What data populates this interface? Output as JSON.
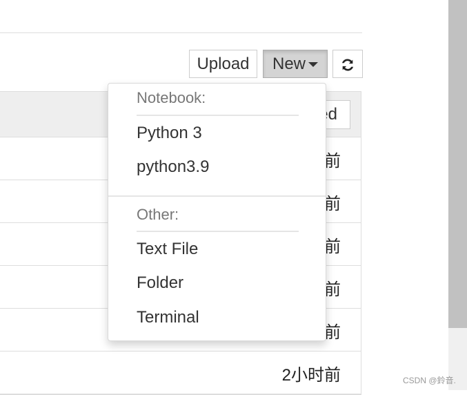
{
  "toolbar": {
    "upload_label": "Upload",
    "new_label": "New",
    "refresh_icon": "refresh-icon"
  },
  "table": {
    "header_sort_label": "ed",
    "rows": [
      "前",
      "前",
      "前",
      "前",
      "前",
      "2小时前"
    ]
  },
  "new_menu": {
    "notebook_header": "Notebook:",
    "notebook_items": [
      "Python 3",
      "python3.9"
    ],
    "other_header": "Other:",
    "other_items": [
      "Text File",
      "Folder",
      "Terminal"
    ]
  },
  "watermark": "CSDN @鈴音."
}
